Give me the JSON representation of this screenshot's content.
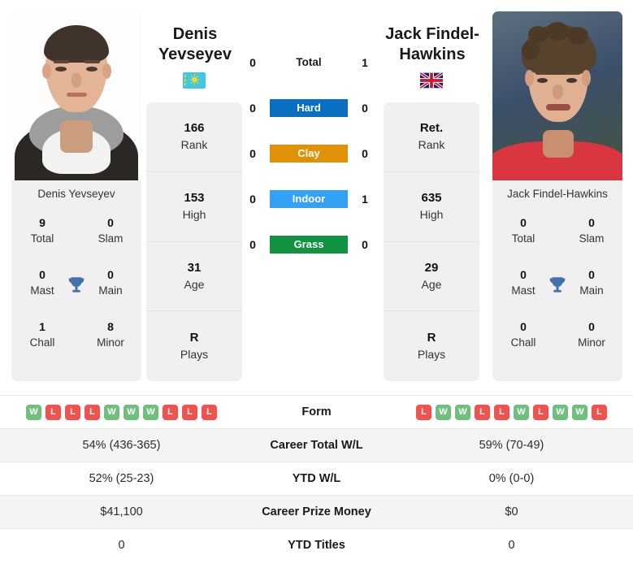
{
  "players": {
    "left": {
      "display_name_line1": "Denis",
      "display_name_line2": "Yevseyev",
      "full_name": "Denis Yevseyev",
      "country": "Kazakhstan",
      "flag_icon": "kazakhstan-flag-icon",
      "photo_alt": "Denis Yevseyev headshot",
      "titles": {
        "total": "9",
        "total_label": "Total",
        "slam": "0",
        "slam_label": "Slam",
        "mast": "0",
        "mast_label": "Mast",
        "main": "0",
        "main_label": "Main",
        "chall": "1",
        "chall_label": "Chall",
        "minor": "8",
        "minor_label": "Minor"
      },
      "stats": [
        {
          "value": "166",
          "label": "Rank"
        },
        {
          "value": "153",
          "label": "High"
        },
        {
          "value": "31",
          "label": "Age"
        },
        {
          "value": "R",
          "label": "Plays"
        }
      ],
      "form": [
        "W",
        "L",
        "L",
        "L",
        "W",
        "W",
        "W",
        "L",
        "L",
        "L"
      ],
      "career_total_wl": "54% (436-365)",
      "ytd_wl": "52% (25-23)",
      "career_prize_money": "$41,100",
      "ytd_titles": "0"
    },
    "right": {
      "display_name_line1": "Jack Findel-",
      "display_name_line2": "Hawkins",
      "full_name": "Jack Findel-Hawkins",
      "country": "United Kingdom",
      "flag_icon": "united-kingdom-flag-icon",
      "photo_alt": "Jack Findel-Hawkins headshot",
      "titles": {
        "total": "0",
        "total_label": "Total",
        "slam": "0",
        "slam_label": "Slam",
        "mast": "0",
        "mast_label": "Mast",
        "main": "0",
        "main_label": "Main",
        "chall": "0",
        "chall_label": "Chall",
        "minor": "0",
        "minor_label": "Minor"
      },
      "stats": [
        {
          "value": "Ret.",
          "label": "Rank"
        },
        {
          "value": "635",
          "label": "High"
        },
        {
          "value": "29",
          "label": "Age"
        },
        {
          "value": "R",
          "label": "Plays"
        }
      ],
      "form": [
        "L",
        "W",
        "W",
        "L",
        "L",
        "W",
        "L",
        "W",
        "W",
        "L"
      ],
      "career_total_wl": "59% (70-49)",
      "ytd_wl": "0% (0-0)",
      "career_prize_money": "$0",
      "ytd_titles": "0"
    }
  },
  "head_to_head": [
    {
      "label": "Total",
      "left": "0",
      "right": "1",
      "color": "",
      "style": "plain"
    },
    {
      "label": "Hard",
      "left": "0",
      "right": "0",
      "color": "#0b6fc0",
      "style": "pill"
    },
    {
      "label": "Clay",
      "left": "0",
      "right": "0",
      "color": "#e09207",
      "style": "pill"
    },
    {
      "label": "Indoor",
      "left": "0",
      "right": "1",
      "color": "#33a2f5",
      "style": "pill"
    },
    {
      "label": "Grass",
      "left": "0",
      "right": "0",
      "color": "#119341",
      "style": "pill"
    }
  ],
  "comparison_rows": [
    {
      "label": "Form",
      "type": "form"
    },
    {
      "label": "Career Total W/L",
      "type": "text",
      "key": "career_total_wl"
    },
    {
      "label": "YTD W/L",
      "type": "text",
      "key": "ytd_wl"
    },
    {
      "label": "Career Prize Money",
      "type": "text",
      "key": "career_prize_money"
    },
    {
      "label": "YTD Titles",
      "type": "text",
      "key": "ytd_titles"
    }
  ],
  "icons": {
    "trophy": "trophy-icon"
  },
  "colors": {
    "win_badge": "#71bf7e",
    "loss_badge": "#ef5350",
    "trophy": "#4272ab",
    "panel_bg": "#f0f0f0",
    "row_alt_bg": "#f4f4f4"
  }
}
